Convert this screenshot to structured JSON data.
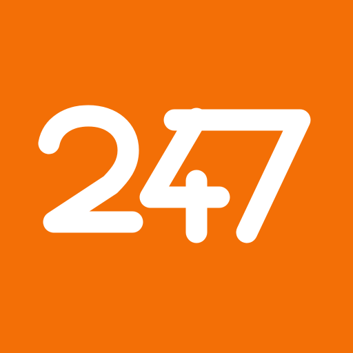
{
  "logo": {
    "text": "247",
    "icon": "247-logo-icon",
    "background_color": "#F36F06",
    "glyph_color": "#FFFFFF"
  }
}
